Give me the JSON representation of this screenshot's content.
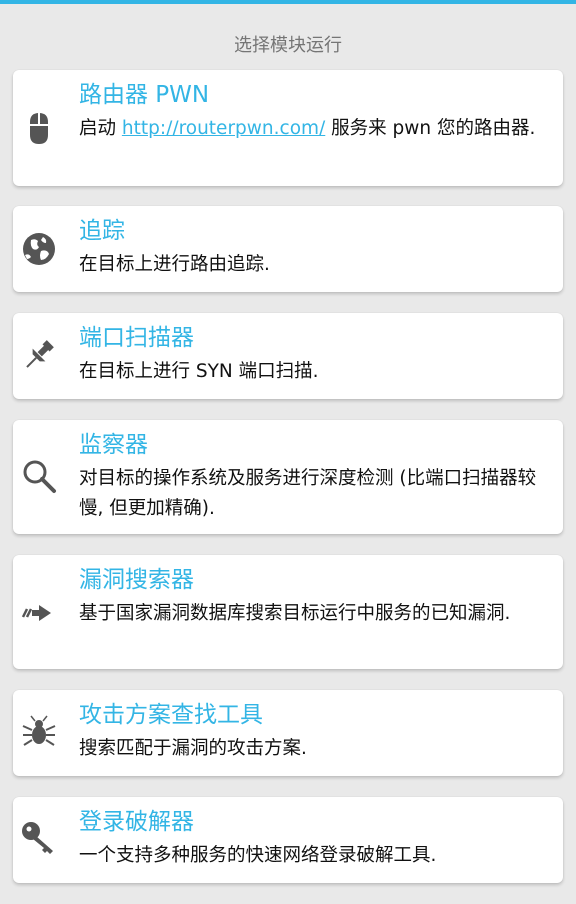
{
  "header": {
    "title": "选择模块运行"
  },
  "modules": [
    {
      "title": "路由器 PWN",
      "desc_prefix": "启动 ",
      "desc_link": "http://routerpwn.com/",
      "desc_suffix": " 服务来 pwn 您的路由器.",
      "icon": "mouse-icon"
    },
    {
      "title": "追踪",
      "desc": "在目标上进行路由追踪.",
      "icon": "globe-icon"
    },
    {
      "title": "端口扫描器",
      "desc": "在目标上进行 SYN 端口扫描.",
      "icon": "pin-icon"
    },
    {
      "title": "监察器",
      "desc": "对目标的操作系统及服务进行深度检测 (比端口扫描器较慢, 但更加精确).",
      "icon": "magnifier-icon"
    },
    {
      "title": "漏洞搜索器",
      "desc": "基于国家漏洞数据库搜索目标运行中服务的已知漏洞.",
      "icon": "arrow-right-icon"
    },
    {
      "title": "攻击方案查找工具",
      "desc": "搜索匹配于漏洞的攻击方案.",
      "icon": "bug-icon"
    },
    {
      "title": "登录破解器",
      "desc": "一个支持多种服务的快速网络登录破解工具.",
      "icon": "key-icon"
    }
  ],
  "colors": {
    "accent": "#33b5e5",
    "background": "#e9e9e9",
    "card": "#ffffff",
    "text": "#111111",
    "header_text": "#757575"
  }
}
